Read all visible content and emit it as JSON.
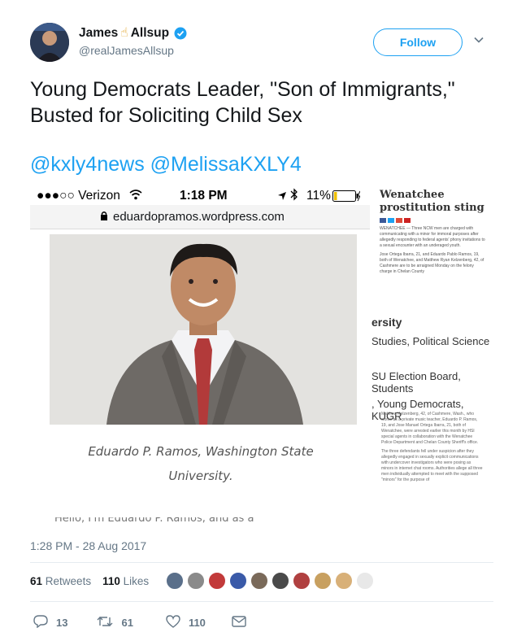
{
  "author": {
    "name_first": "James",
    "name_emoji": "☝",
    "name_last": "Allsup",
    "handle": "@realJamesAllsup",
    "verified": true
  },
  "follow_label": "Follow",
  "tweet_text": "Young Democrats Leader, \"Son of Immigrants,\" Busted for Soliciting Child Sex",
  "mentions": "@kxly4news @MelissaKXLY4",
  "screenshot": {
    "status_carrier": "●●●○○ Verizon",
    "status_time": "1:18 PM",
    "status_battery": "11%",
    "url": "eduardopramos.wordpress.com",
    "caption_line1": "Eduardo P. Ramos, Washington State",
    "caption_line2": "University.",
    "cutoff_text": "Hello, I'm Eduardo P. Ramos, and as a",
    "side_headline_1": "Wenatchee",
    "side_headline_2": "prostitution sting",
    "side_paragraph_1": "WENATCHEE — Three NCW men are charged with communicating with a minor for immoral purposes after allegedly responding to federal agents' phony invitations to a sexual encounter with an underaged youth.",
    "side_paragraph_2": "Jose Ortega Ibarra, 21, and Eduardo Pablo Ramos, 19, both of Wenatchee, and Matthew Ryan Kelzenberg, 42, of Cashmere are to be arraigned Monday on the felony charge in Chelan County",
    "side_mid_1": "ersity",
    "side_mid_2": "Studies, Political Science",
    "side_mid_3": "SU Election Board, Students",
    "side_mid_4": ", Young Democrats, KUGR",
    "side_paragraph_3": "Matthew Kelzenberg, 42, of Cashmere, Wash., who works as a private music teacher, Eduardo P. Ramos, 19, and Jose Manuel Ortega Ibarra, 21, both of Wenatchee, were arrested earlier this month by HSI special agents in collaboration with the Wenatchee Police Department and Chelan County Sheriff's office.",
    "side_paragraph_4": "The three defendants fell under suspicion after they allegedly engaged in sexually explicit communications with undercover investigators who were posing as minors in internet chat rooms. Authorities allege all three men individually attempted to meet with the supposed \"minors\" for the purpose of"
  },
  "timestamp": "1:28 PM - 28 Aug 2017",
  "stats": {
    "retweets_count": "61",
    "retweets_label": "Retweets",
    "likes_count": "110",
    "likes_label": "Likes"
  },
  "likers_colors": [
    "#5a6f8a",
    "#8a8a8a",
    "#c23a3a",
    "#3a5aa8",
    "#7a6a5a",
    "#4a4a4a",
    "#b04040",
    "#c8a060",
    "#d8b078",
    "#e8e8e8"
  ],
  "actions": {
    "reply_count": "13",
    "retweet_count": "61",
    "like_count": "110"
  }
}
